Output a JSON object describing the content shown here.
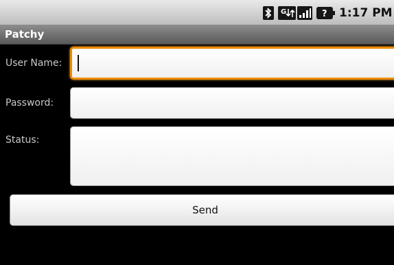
{
  "status_bar": {
    "time": "1:17 PM",
    "icons": [
      "bluetooth-icon",
      "gsm-data-icon",
      "signal-icon",
      "battery-unknown-icon"
    ]
  },
  "app": {
    "title": "Patchy"
  },
  "form": {
    "username_label": "User Name:",
    "username_value": "",
    "password_label": "Password:",
    "password_value": "",
    "status_label": "Status:",
    "status_value": ""
  },
  "send_button": {
    "label": "Send"
  },
  "colors": {
    "focus": "#f08a00",
    "background": "#000000"
  }
}
